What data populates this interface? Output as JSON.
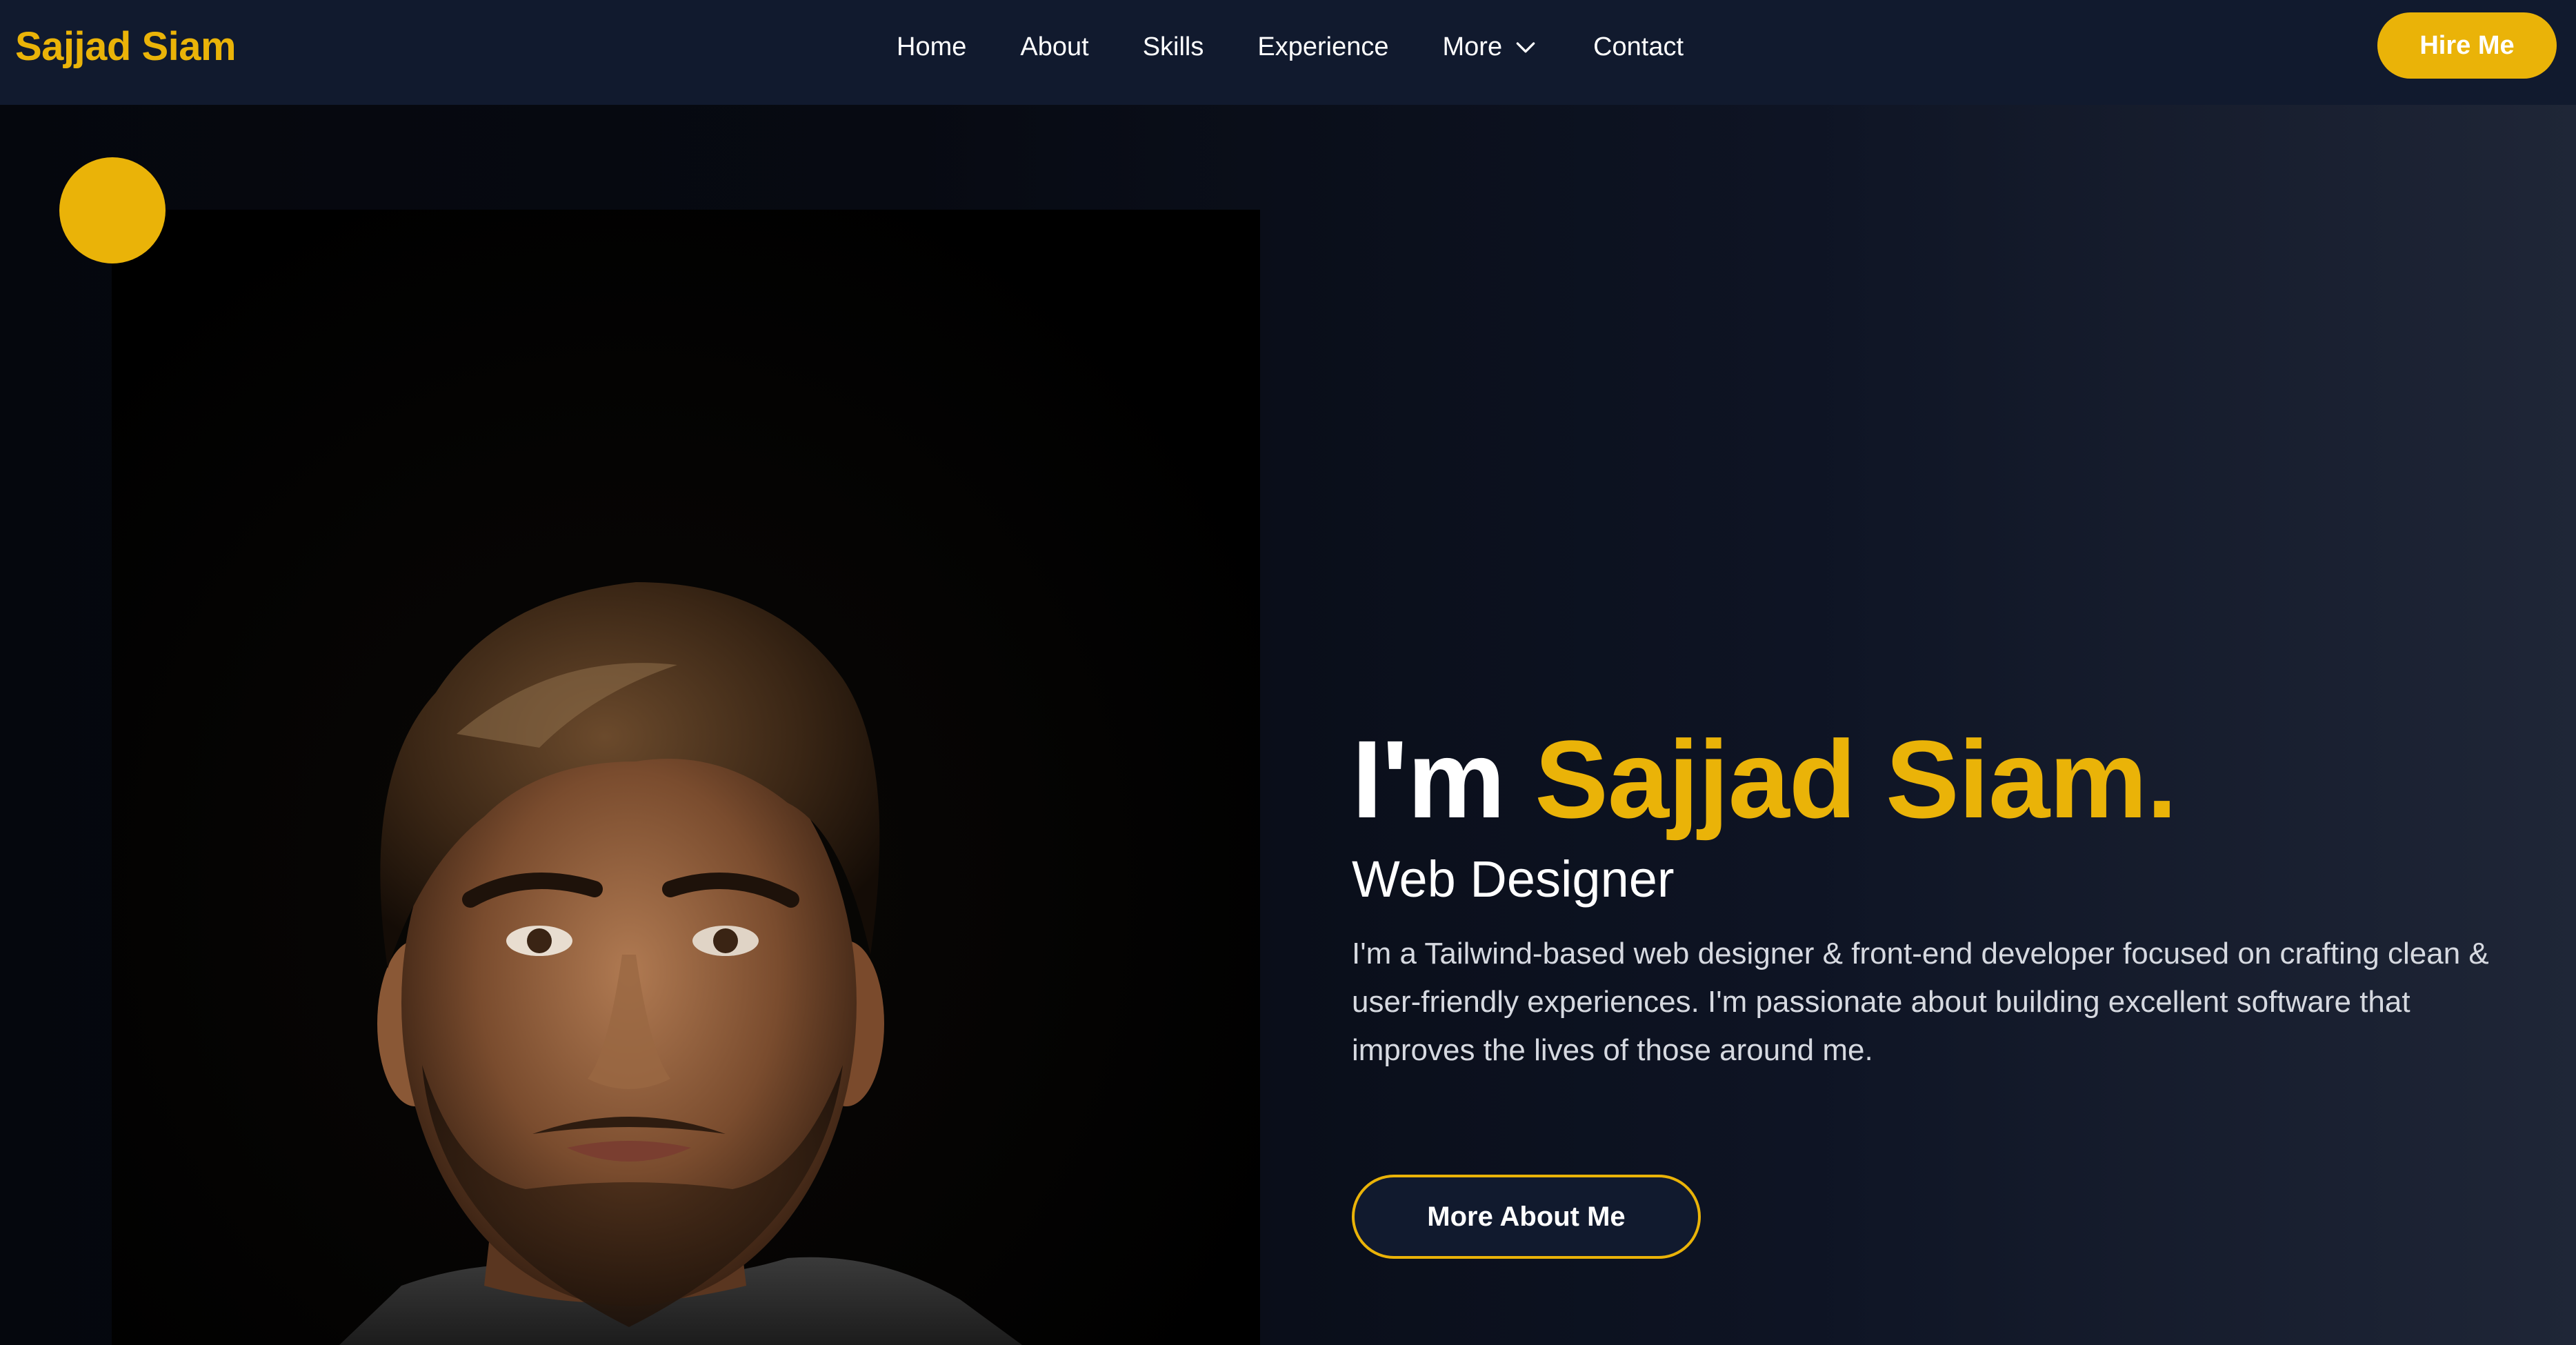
{
  "brand": {
    "name": "Sajjad Siam"
  },
  "nav": {
    "items": [
      {
        "label": "Home"
      },
      {
        "label": "About"
      },
      {
        "label": "Skills"
      },
      {
        "label": "Experience"
      },
      {
        "label": "More"
      },
      {
        "label": "Contact"
      }
    ],
    "more_icon": "chevron-down-icon"
  },
  "header": {
    "cta_label": "Hire Me"
  },
  "hero": {
    "greeting": "I'm",
    "name": "Sajjad Siam.",
    "role": "Web Designer",
    "bio": "I'm a Tailwind-based web designer & front-end developer focused on crafting clean & user-friendly experiences. I'm passionate about building excellent software that improves the lives of those around me.",
    "cta_label": "More About Me"
  },
  "colors": {
    "accent": "#eab308",
    "nav_bg": "#111a2e",
    "text": "#ffffff",
    "muted_text": "#d6d9e0"
  }
}
